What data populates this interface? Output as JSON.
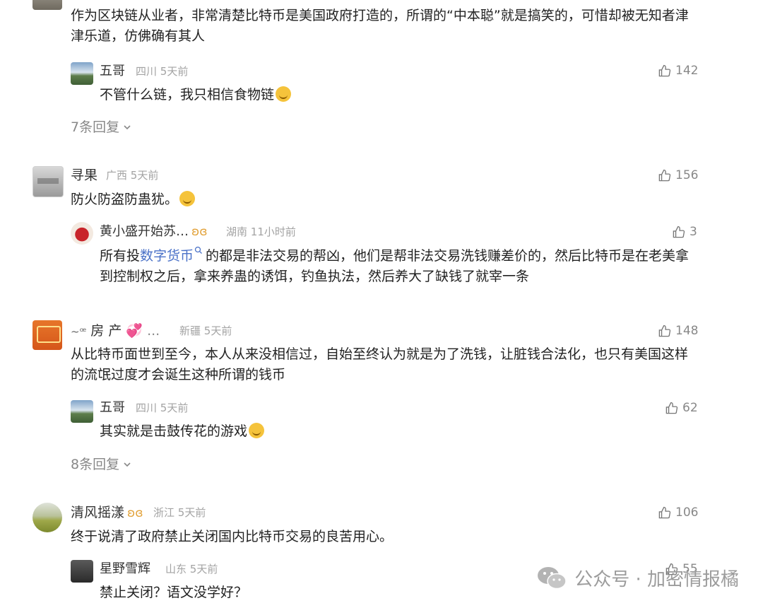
{
  "comments": [
    {
      "text": "作为区块链从业者，非常清楚比特币是美国政府打造的，所谓的“中本聪”就是搞笑的，可惜却被无知者津津乐道，仿佛确有其人",
      "replies": [
        {
          "name": "五哥",
          "location": "四川",
          "time": "5天前",
          "likes": "142",
          "text": "不管什么链，我只相信食物链"
        }
      ],
      "more_label": "7条回复"
    },
    {
      "name": "寻果",
      "location": "广西",
      "time": "5天前",
      "likes": "156",
      "text": "防火防盗防蛊犹。",
      "replies": [
        {
          "name": "黄小盛开始苏…",
          "location": "湖南",
          "time": "11小时前",
          "likes": "3",
          "text_before": "所有投",
          "link": "数字货币",
          "text_after": "的都是非法交易的帮凶，他们是帮非法交易洗钱赚差价的，然后比特币是在老美拿到控制权之后，拿来养蛊的诱饵，钓鱼执法，然后养大了缺钱了就宰一条"
        }
      ]
    },
    {
      "name": "房 产",
      "ellipsis": "...",
      "location": "新疆",
      "time": "5天前",
      "likes": "148",
      "text": "从比特币面世到至今，本人从来没相信过，自始至终认为就是为了洗钱，让脏钱合法化，也只有美国这样的流氓过度才会诞生这种所谓的钱币",
      "replies": [
        {
          "name": "五哥",
          "location": "四川",
          "time": "5天前",
          "likes": "62",
          "text": "其实就是击鼓传花的游戏"
        }
      ],
      "more_label": "8条回复"
    },
    {
      "name": "清风摇漾",
      "location": "浙江",
      "time": "5天前",
      "likes": "106",
      "text": "终于说清了政府禁止关闭国内比特币交易的良苦用心。",
      "replies": [
        {
          "name": "星野雪辉",
          "location": "山东",
          "time": "5天前",
          "likes": "55",
          "text": "禁止关闭？语文没学好？"
        }
      ]
    }
  ],
  "watermark": {
    "text": "公众号 · 加密情报橘"
  },
  "icons": {
    "like": "thumbs-up-icon",
    "chevron": "chevron-down-icon",
    "vip": "vip-badge-icon",
    "search": "search-icon",
    "wechat": "wechat-icon"
  }
}
